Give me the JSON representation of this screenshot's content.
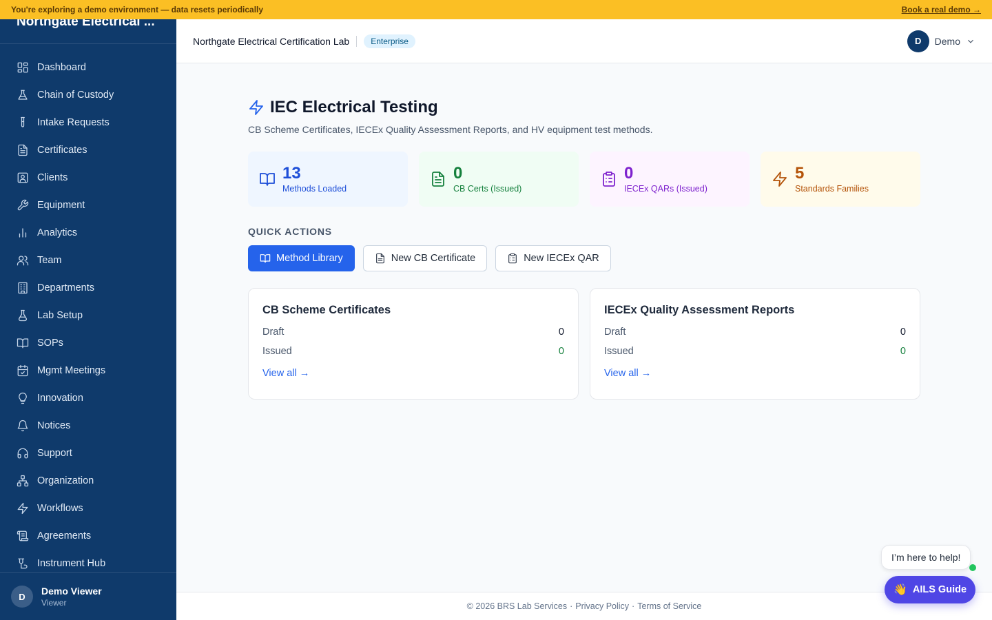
{
  "banner": {
    "text": "You're exploring a demo environment — data resets periodically",
    "link": "Book a real demo →"
  },
  "sidebar": {
    "brand": "Northgate Electrical ...",
    "items": [
      {
        "label": "Dashboard",
        "icon": "grid-icon"
      },
      {
        "label": "Chain of Custody",
        "icon": "flask-icon"
      },
      {
        "label": "Intake Requests",
        "icon": "test-tube-icon"
      },
      {
        "label": "Certificates",
        "icon": "document-icon"
      },
      {
        "label": "Clients",
        "icon": "contact-icon"
      },
      {
        "label": "Equipment",
        "icon": "wrench-icon"
      },
      {
        "label": "Analytics",
        "icon": "bar-chart-icon"
      },
      {
        "label": "Team",
        "icon": "users-icon"
      },
      {
        "label": "Departments",
        "icon": "building-icon"
      },
      {
        "label": "Lab Setup",
        "icon": "beaker-icon"
      },
      {
        "label": "SOPs",
        "icon": "book-icon"
      },
      {
        "label": "Mgmt Meetings",
        "icon": "calendar-check-icon"
      },
      {
        "label": "Innovation",
        "icon": "lightbulb-icon"
      },
      {
        "label": "Notices",
        "icon": "bell-icon"
      },
      {
        "label": "Support",
        "icon": "headphones-icon"
      },
      {
        "label": "Organization",
        "icon": "org-chart-icon"
      },
      {
        "label": "Workflows",
        "icon": "bolt-icon"
      },
      {
        "label": "Agreements",
        "icon": "scroll-icon"
      },
      {
        "label": "Instrument Hub",
        "icon": "instrument-icon"
      }
    ],
    "user": {
      "initial": "D",
      "name": "Demo Viewer",
      "role": "Viewer"
    }
  },
  "header": {
    "org": "Northgate Electrical Certification Lab",
    "plan": "Enterprise",
    "account_initial": "D",
    "account_name": "Demo"
  },
  "page": {
    "title": "IEC Electrical Testing",
    "subtitle": "CB Scheme Certificates, IECEx Quality Assessment Reports, and HV equipment test methods."
  },
  "stats": [
    {
      "value": "13",
      "label": "Methods Loaded",
      "color": "#1d4ed8"
    },
    {
      "value": "0",
      "label": "CB Certs (Issued)",
      "color": "#15803d"
    },
    {
      "value": "0",
      "label": "IECEx QARs (Issued)",
      "color": "#7e22ce"
    },
    {
      "value": "5",
      "label": "Standards Families",
      "color": "#b45309"
    }
  ],
  "quick_actions": {
    "label": "QUICK ACTIONS",
    "buttons": [
      "Method Library",
      "New CB Certificate",
      "New IECEx QAR"
    ]
  },
  "cards": [
    {
      "title": "CB Scheme Certificates",
      "rows": [
        {
          "label": "Draft",
          "value": "0"
        },
        {
          "label": "Issued",
          "value": "0"
        }
      ],
      "link": "View all →"
    },
    {
      "title": "IECEx Quality Assessment Reports",
      "rows": [
        {
          "label": "Draft",
          "value": "0"
        },
        {
          "label": "Issued",
          "value": "0"
        }
      ],
      "link": "View all →"
    }
  ],
  "footer": {
    "copyright": "© 2026 BRS Lab Services",
    "privacy": "Privacy Policy",
    "terms": "Terms of Service",
    "sep": "·"
  },
  "assistant": {
    "bubble": "I’m here to help!",
    "button": "AILS Guide",
    "wave": "👋"
  },
  "colors": {
    "accent": "#2563eb",
    "sidebar": "#0f3a6b",
    "banner": "#fbbf24"
  }
}
